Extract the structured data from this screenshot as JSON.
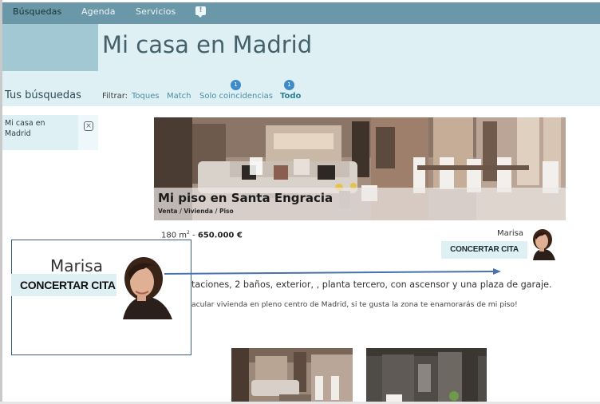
{
  "nav": {
    "items": [
      "Búsquedas",
      "Agenda",
      "Servicios"
    ],
    "message_icon": "!"
  },
  "page": {
    "title": "Mi casa en Madrid"
  },
  "sidebar": {
    "title": "Tus búsquedas",
    "items": [
      {
        "label": "Mi casa en Madrid"
      }
    ]
  },
  "filter": {
    "label": "Filtrar:",
    "options": [
      {
        "label": "Toques"
      },
      {
        "label": "Match"
      },
      {
        "label": "Solo coincidencias",
        "badge": "1"
      },
      {
        "label": "Todo",
        "badge": "1",
        "active": true
      }
    ]
  },
  "listing": {
    "title": "Mi piso en Santa Engracia",
    "subtitle": "Venta / Vivienda / Piso",
    "area": "180 m",
    "area_sup": "2",
    "separator": " - ",
    "price": "650.000 €",
    "description": "taciones, 2 baños, exterior, , planta tercero, con ascensor y una plaza de garaje.",
    "extra": "acular vivienda en pleno centro de Madrid, si te gusta la zona te enamorarás de mi piso!"
  },
  "agent": {
    "name": "Marisa",
    "button": "CONCERTAR CITA"
  },
  "callout": {
    "name": "Marisa",
    "button": "CONCERTAR CITA"
  },
  "colors": {
    "nav_bg": "#6a98a8",
    "panel_light": "#dff0f5",
    "panel_mid": "#a2c8d4",
    "link": "#4a8ea3",
    "badge": "#3d8bc9",
    "arrow": "#4a72b0",
    "callout_border": "#3b5d80"
  }
}
